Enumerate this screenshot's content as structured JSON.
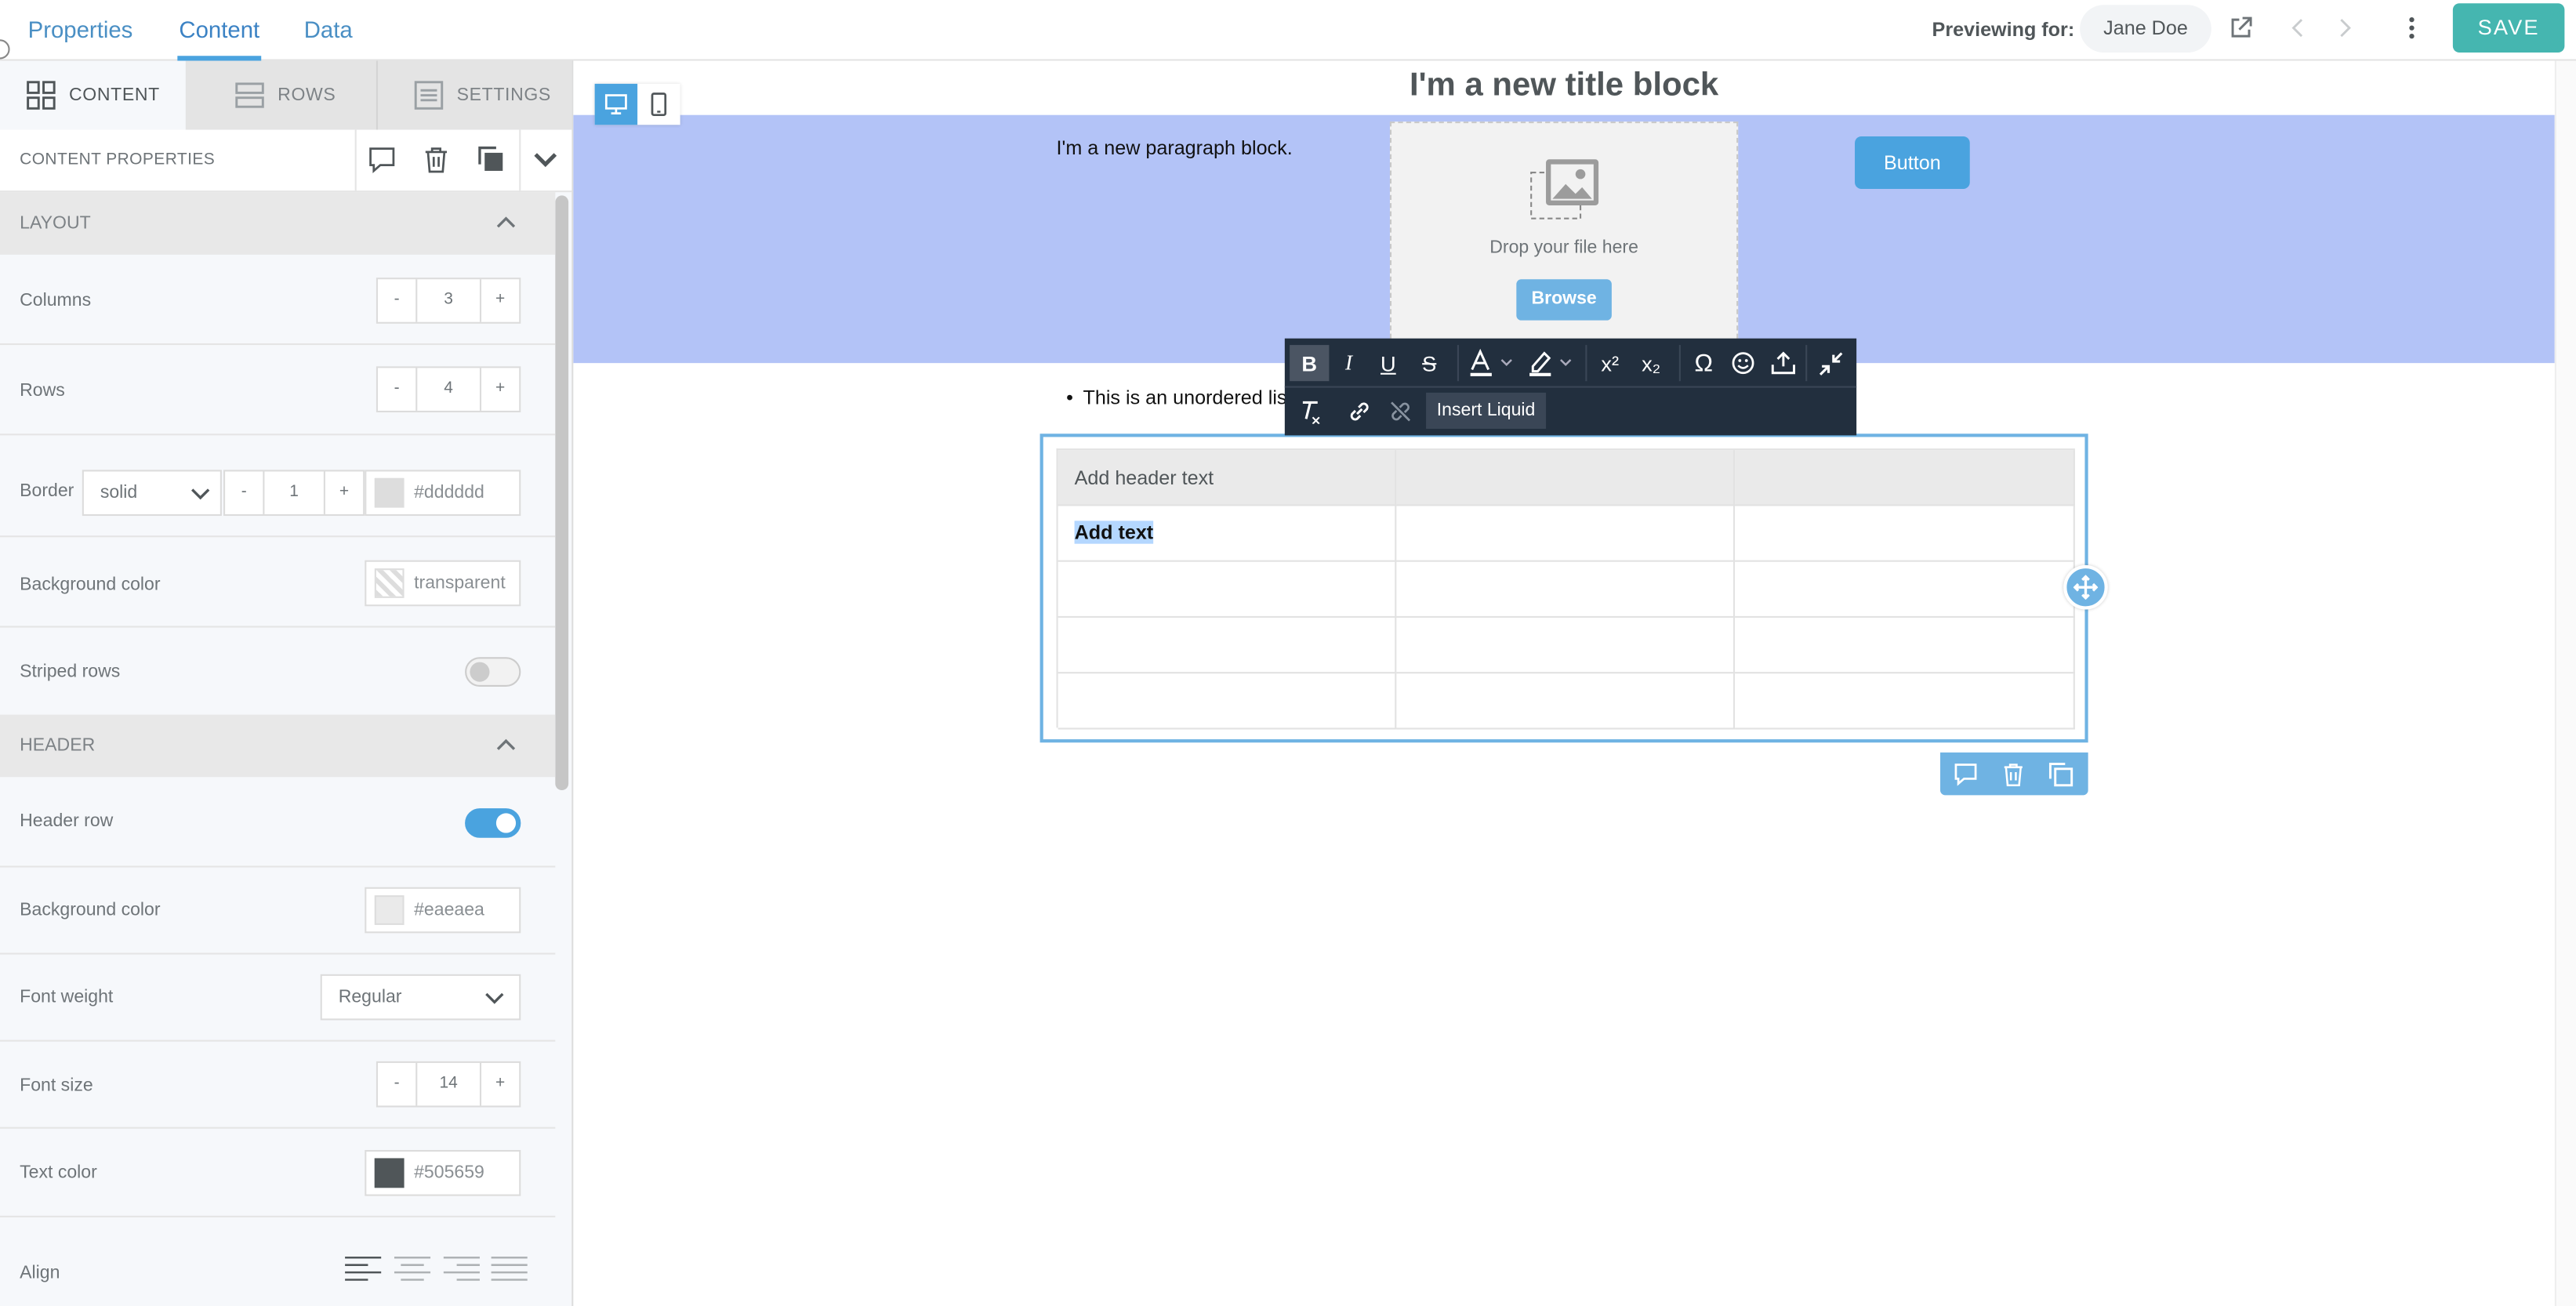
{
  "topbar": {
    "tabs": [
      "Properties",
      "Content",
      "Data"
    ],
    "active_tab": "Content",
    "previewing_label": "Previewing for:",
    "previewing_user": "Jane Doe",
    "save_label": "SAVE"
  },
  "sidebar": {
    "tabs": [
      {
        "label": "CONTENT",
        "icon": "grid-icon"
      },
      {
        "label": "ROWS",
        "icon": "rows-icon"
      },
      {
        "label": "SETTINGS",
        "icon": "settings-list-icon"
      }
    ],
    "content_properties_label": "CONTENT PROPERTIES",
    "layout": {
      "title": "LAYOUT",
      "columns_label": "Columns",
      "columns_value": "3",
      "rows_label": "Rows",
      "rows_value": "4",
      "border_label": "Border",
      "border_style": "solid",
      "border_width": "1",
      "border_color": "#dddddd",
      "bg_label": "Background color",
      "bg_value": "transparent",
      "striped_label": "Striped rows",
      "striped_on": false
    },
    "header": {
      "title": "HEADER",
      "header_row_label": "Header row",
      "header_row_on": true,
      "bg_label": "Background color",
      "bg_value": "#eaeaea",
      "font_weight_label": "Font weight",
      "font_weight_value": "Regular",
      "font_size_label": "Font size",
      "font_size_value": "14",
      "text_color_label": "Text color",
      "text_color_value": "#505659",
      "align_label": "Align"
    },
    "stepper_minus": "-",
    "stepper_plus": "+"
  },
  "canvas": {
    "title_block": "I'm a new title block",
    "paragraph_block": "I'm a new paragraph block.",
    "drop_text": "Drop your file here",
    "browse_label": "Browse",
    "button_label": "Button",
    "list_item": "This is an unordered lis",
    "row_bg_color": "#b3c3f7",
    "table": {
      "header": [
        "Add header text",
        "",
        ""
      ],
      "rows": [
        [
          "Add text",
          "",
          ""
        ],
        [
          "",
          "",
          ""
        ],
        [
          "",
          "",
          ""
        ],
        [
          "",
          "",
          ""
        ]
      ]
    },
    "toolbar": {
      "insert_liquid_label": "Insert Liquid",
      "omega": "Ω",
      "superscript": "x²",
      "subscript": "x₂"
    }
  }
}
